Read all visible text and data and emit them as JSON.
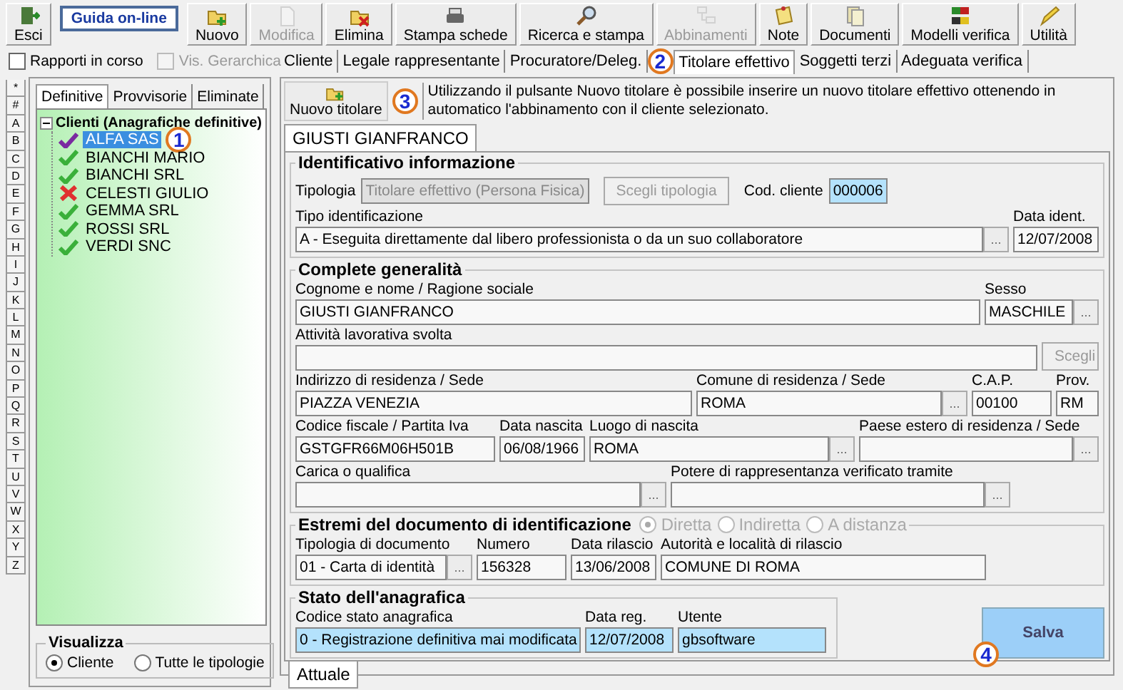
{
  "toolbar": [
    {
      "label": "Esci",
      "kind": "tool",
      "disabled": false
    },
    {
      "label": "Guida on-line",
      "kind": "link",
      "disabled": false
    },
    {
      "label": "Nuovo",
      "kind": "tool",
      "disabled": false
    },
    {
      "label": "Modifica",
      "kind": "tool",
      "disabled": true
    },
    {
      "label": "Elimina",
      "kind": "tool",
      "disabled": false
    },
    {
      "label": "Stampa schede",
      "kind": "tool",
      "disabled": false
    },
    {
      "label": "Ricerca e stampa",
      "kind": "tool",
      "disabled": false
    },
    {
      "label": "Abbinamenti",
      "kind": "tool",
      "disabled": true
    },
    {
      "label": "Note",
      "kind": "tool",
      "disabled": false
    },
    {
      "label": "Documenti",
      "kind": "tool",
      "disabled": false
    },
    {
      "label": "Modelli verifica",
      "kind": "tool",
      "disabled": false
    },
    {
      "label": "Utilità",
      "kind": "tool",
      "disabled": false
    }
  ],
  "options": [
    {
      "label": "Rapporti in corso",
      "checked": false,
      "disabled": false
    },
    {
      "label": "Vis. Gerarchica",
      "checked": false,
      "disabled": true
    }
  ],
  "tabs": [
    {
      "label": "Cliente",
      "selected": false
    },
    {
      "label": "Legale rappresentante",
      "selected": false
    },
    {
      "label": "Procuratore/Deleg.",
      "selected": false,
      "callout": "2"
    },
    {
      "label": "Titolare effettivo",
      "selected": true
    },
    {
      "label": "Soggetti terzi",
      "selected": false
    },
    {
      "label": "Adeguata verifica",
      "selected": false
    }
  ],
  "alphabet": [
    "*",
    "#",
    "A",
    "B",
    "C",
    "D",
    "E",
    "F",
    "G",
    "H",
    "I",
    "J",
    "K",
    "L",
    "M",
    "N",
    "O",
    "P",
    "Q",
    "R",
    "S",
    "T",
    "U",
    "V",
    "W",
    "X",
    "Y",
    "Z"
  ],
  "list_tabs": [
    {
      "label": "Definitive",
      "selected": true
    },
    {
      "label": "Provvisorie",
      "selected": false
    },
    {
      "label": "Eliminate",
      "selected": false
    }
  ],
  "tree": {
    "label": "Clienti (Anagrafiche definitive)",
    "expanded": true,
    "children": [
      {
        "label": "ALFA SAS",
        "kind": "current",
        "selected": true,
        "callout": "1"
      },
      {
        "label": "BIANCHI MARIO",
        "kind": "ok",
        "selected": false
      },
      {
        "label": "BIANCHI SRL",
        "kind": "ok",
        "selected": false
      },
      {
        "label": "CELESTI GIULIO",
        "kind": "error",
        "selected": false
      },
      {
        "label": "GEMMA SRL",
        "kind": "ok",
        "selected": false
      },
      {
        "label": "ROSSI SRL",
        "kind": "ok",
        "selected": false
      },
      {
        "label": "VERDI SNC",
        "kind": "ok",
        "selected": false
      }
    ]
  },
  "view": {
    "title": "Visualizza",
    "options": [
      {
        "label": "Cliente",
        "selected": true
      },
      {
        "label": "Tutte le tipologie",
        "selected": false
      }
    ]
  },
  "new_button": {
    "label": "Nuovo titolare",
    "callout": "3"
  },
  "info": "Utilizzando il pulsante Nuovo titolare è possibile inserire un nuovo titolare effettivo ottenendo in automatico l'abbinamento con il cliente selezionato.",
  "record_tab": {
    "label": "GIUSTI GIANFRANCO",
    "selected": true
  },
  "groups": [
    {
      "title": "Identificativo informazione",
      "rows": [
        {
          "fields": [
            {
              "kind": "inline_field",
              "label": "Tipologia",
              "value": "Titolare effettivo (Persona Fisica)",
              "highlighted": false,
              "disabled": true
            },
            {
              "kind": "button",
              "label": "Scegli tipologia",
              "disabled": true
            },
            {
              "kind": "inline_field",
              "label": "Cod. cliente",
              "value": "000006",
              "highlighted": true,
              "disabled": false
            }
          ]
        },
        {
          "fields": [
            {
              "kind": "field",
              "label": "Tipo identificazione",
              "value": "A - Eseguita direttamente dal libero professionista o da un suo collaboratore",
              "button": "...",
              "highlighted": false,
              "disabled": false
            },
            {
              "kind": "field",
              "label": "Data ident.",
              "value": "12/07/2008",
              "highlighted": false,
              "disabled": false
            }
          ]
        }
      ]
    },
    {
      "title": "Complete generalità",
      "rows": [
        {
          "fields": [
            {
              "kind": "field",
              "label": "Cognome e nome / Ragione sociale",
              "value": "GIUSTI GIANFRANCO",
              "highlighted": false,
              "disabled": false
            },
            {
              "kind": "field",
              "label": "Sesso",
              "value": "MASCHILE",
              "button": "...",
              "highlighted": false,
              "disabled": false
            }
          ]
        },
        {
          "fields": [
            {
              "kind": "field",
              "label": "Attività lavorativa svolta",
              "highlighted": false,
              "disabled": false
            },
            {
              "kind": "button",
              "label": "Scegli",
              "disabled": true
            }
          ]
        },
        {
          "fields": [
            {
              "kind": "field",
              "label": "Indirizzo di residenza / Sede",
              "value": "PIAZZA VENEZIA",
              "highlighted": false,
              "disabled": false
            },
            {
              "kind": "field",
              "label": "Comune di residenza / Sede",
              "value": "ROMA",
              "button": "...",
              "highlighted": false,
              "disabled": false
            },
            {
              "kind": "field",
              "label": "C.A.P.",
              "value": "00100",
              "highlighted": false,
              "disabled": false
            },
            {
              "kind": "field",
              "label": "Prov.",
              "value": "RM",
              "highlighted": false,
              "disabled": false
            }
          ]
        },
        {
          "fields": [
            {
              "kind": "field",
              "label": "Codice fiscale / Partita Iva",
              "value": "GSTGFR66M06H501B",
              "highlighted": false,
              "disabled": false
            },
            {
              "kind": "field",
              "label": "Data nascita",
              "value": "06/08/1966",
              "highlighted": false,
              "disabled": false
            },
            {
              "kind": "field",
              "label": "Luogo di nascita",
              "value": "ROMA",
              "button": "...",
              "highlighted": false,
              "disabled": false
            },
            {
              "kind": "field",
              "label": "Paese estero di residenza / Sede",
              "button": "...",
              "highlighted": false,
              "disabled": false
            }
          ]
        },
        {
          "fields": [
            {
              "kind": "field",
              "label": "Carica o qualifica",
              "button": "...",
              "highlighted": false,
              "disabled": false
            },
            {
              "kind": "field",
              "label": "Potere di rappresentanza verificato tramite",
              "button": "...",
              "highlighted": false,
              "disabled": false
            }
          ]
        }
      ]
    },
    {
      "title": "Estremi del documento di identificazione",
      "modes": [
        {
          "label": "Diretta",
          "selected": true
        },
        {
          "label": "Indiretta",
          "selected": false
        },
        {
          "label": "A distanza",
          "selected": false
        }
      ],
      "modes_disabled": true,
      "rows": [
        {
          "fields": [
            {
              "kind": "field",
              "label": "Tipologia di documento",
              "value": "01 - Carta di identità",
              "button": "...",
              "highlighted": false,
              "disabled": false
            },
            {
              "kind": "field",
              "label": "Numero",
              "value": "156328",
              "highlighted": false,
              "disabled": false
            },
            {
              "kind": "field",
              "label": "Data rilascio",
              "value": "13/06/2008",
              "highlighted": false,
              "disabled": false
            },
            {
              "kind": "field",
              "label": "Autorità e località di rilascio",
              "value": "COMUNE DI ROMA",
              "highlighted": false,
              "disabled": false
            }
          ]
        }
      ]
    },
    {
      "title": "Stato dell'anagrafica",
      "rows": [
        {
          "fields": [
            {
              "kind": "field",
              "label": "Codice stato anagrafica",
              "value": "0 - Registrazione definitiva mai modificata",
              "highlighted": true,
              "disabled": false
            },
            {
              "kind": "field",
              "label": "Data reg.",
              "value": "12/07/2008",
              "highlighted": true,
              "disabled": false
            },
            {
              "kind": "field",
              "label": "Utente",
              "value": "gbsoftware",
              "highlighted": true,
              "disabled": false
            }
          ]
        }
      ]
    }
  ],
  "save_button": {
    "label": "Salva",
    "callout": "4"
  },
  "bottom_tab": {
    "label": "Attuale",
    "selected": true
  }
}
